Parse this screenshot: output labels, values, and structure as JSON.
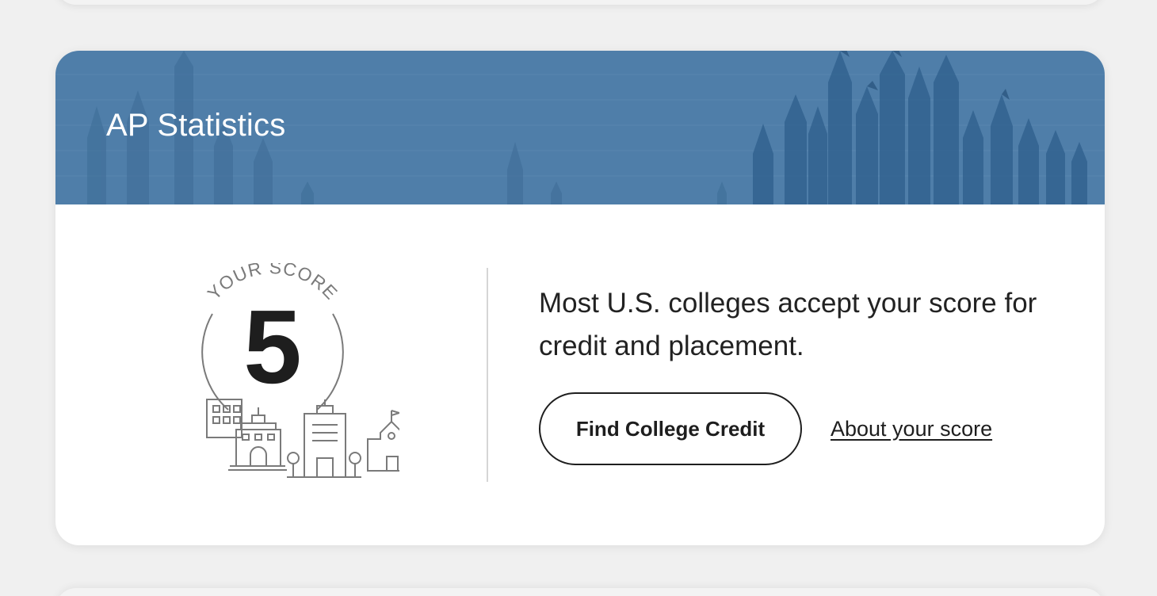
{
  "card": {
    "course_title": "AP Statistics",
    "banner_color": "#4f7ea9",
    "background_art": "colored-pencils-graphic"
  },
  "score": {
    "label": "YOUR SCORE",
    "value": "5",
    "illustration": "college-buildings-icon"
  },
  "result": {
    "message": "Most U.S. colleges accept your score for credit and placement.",
    "find_credit_label": "Find College Credit",
    "about_label": "About your score"
  }
}
